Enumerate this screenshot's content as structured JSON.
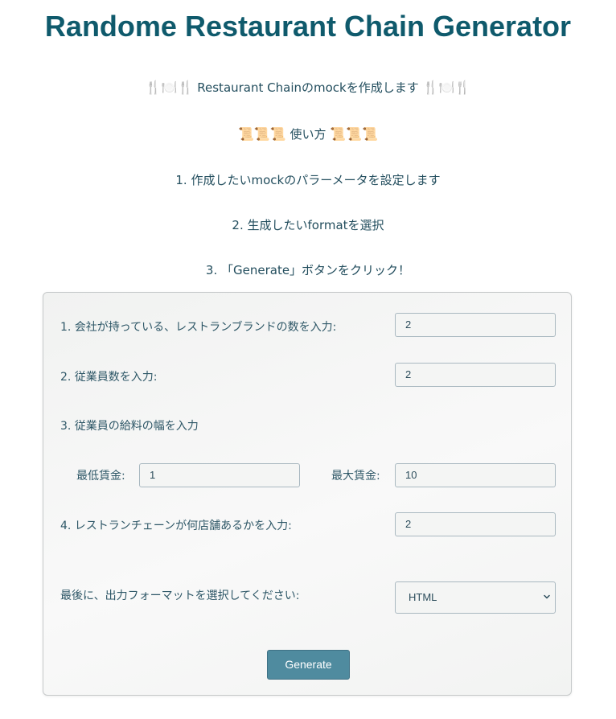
{
  "title": "Randome Restaurant Chain Generator",
  "intro": {
    "left_emoji": "🍴🍽️🍴",
    "text": "Restaurant Chainのmockを作成します",
    "right_emoji": "🍴🍽️🍴"
  },
  "howto": {
    "left_emoji": "📜📜📜",
    "text": "使い方",
    "right_emoji": "📜📜📜"
  },
  "steps": [
    "1. 作成したいmockのパラーメータを設定します",
    "2. 生成したいformatを選択",
    "3. 「Generate」ボタンをクリック！"
  ],
  "form": {
    "brands_label": "1. 会社が持っている、レストランブランドの数を入力:",
    "brands_value": "2",
    "employees_label": "2. 従業員数を入力:",
    "employees_value": "2",
    "salary_label": "3. 従業員の給料の幅を入力",
    "min_wage_label": "最低賃金:",
    "min_wage_value": "1",
    "max_wage_label": "最大賃金:",
    "max_wage_value": "10",
    "stores_label": "4. レストランチェーンが何店舗あるかを入力:",
    "stores_value": "2",
    "format_label": "最後に、出力フォーマットを選択してください:",
    "format_value": "HTML",
    "generate_label": "Generate"
  },
  "colors": {
    "title": "#0f5a6c",
    "text": "#234e5e",
    "button": "#4f8b9f",
    "panel_border": "#c6c9ca"
  },
  "icons": {
    "dropdown": "chevron-down-icon"
  }
}
